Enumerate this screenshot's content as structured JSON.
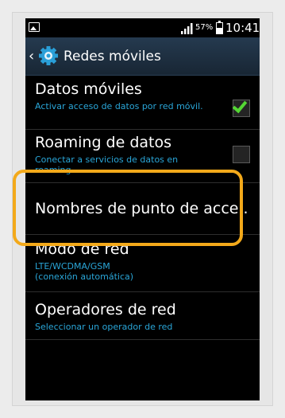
{
  "status_bar": {
    "battery_percent": "57%",
    "battery_level": 0.57,
    "time": "10:41"
  },
  "action_bar": {
    "title": "Redes móviles",
    "icons": [
      "chevron-left-icon",
      "gear-icon"
    ]
  },
  "settings": [
    {
      "title": "Datos móviles",
      "summary": "Activar acceso de datos por red móvil.",
      "checkbox": true,
      "checked": true
    },
    {
      "title": "Roaming de datos",
      "summary": "Conectar a servicios de datos en roaming.",
      "checkbox": true,
      "checked": false
    },
    {
      "title": "Nombres de punto de acce..",
      "highlighted": true
    },
    {
      "title": "Modo de red",
      "summary": "LTE/WCDMA/GSM (conexión automática)"
    },
    {
      "title": "Operadores de red",
      "summary": "Seleccionar un operador de red"
    }
  ],
  "colors": {
    "highlight": "#f3a91a",
    "summary_text": "#2aa6d8",
    "checkmark": "#54d634",
    "action_bar": "#1f3144"
  }
}
